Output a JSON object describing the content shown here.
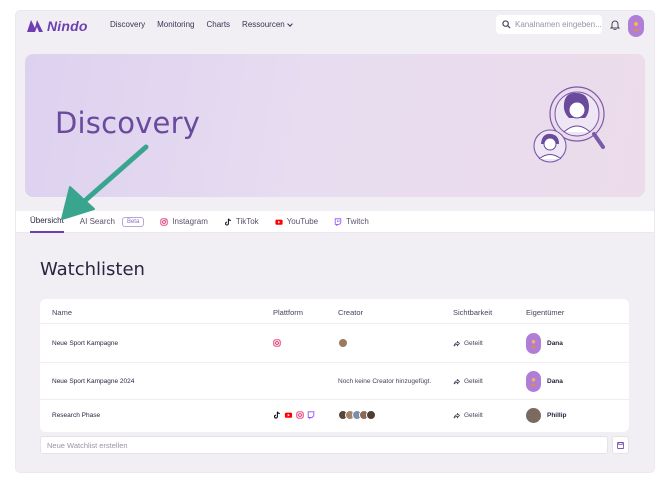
{
  "brand": {
    "name": "Nindo",
    "color": "#6d3fb0"
  },
  "nav": {
    "discovery": "Discovery",
    "monitoring": "Monitoring",
    "charts": "Charts",
    "ressourcen": "Ressourcen"
  },
  "search": {
    "placeholder": "Kanalnamen eingeben..."
  },
  "hero": {
    "title": "Discovery"
  },
  "tabs": {
    "overview": "Übersicht",
    "ai_search": "AI Search",
    "ai_badge": "Beta",
    "instagram": "Instagram",
    "tiktok": "TikTok",
    "youtube": "YouTube",
    "twitch": "Twitch"
  },
  "section": {
    "title": "Watchlisten"
  },
  "table": {
    "headers": {
      "name": "Name",
      "platform": "Plattform",
      "creator": "Creator",
      "visibility": "Sichtbarkeit",
      "owner": "Eigentümer"
    },
    "rows": [
      {
        "name": "Neue Sport Kampagne",
        "platforms": [
          "instagram"
        ],
        "creator_text": "",
        "visibility": "Geteilt",
        "owner": "Dana"
      },
      {
        "name": "Neue Sport Kampagne 2024",
        "platforms": [],
        "creator_text": "Noch keine Creator hinzugefügt.",
        "visibility": "Geteilt",
        "owner": "Dana"
      },
      {
        "name": "Research Phase",
        "platforms": [
          "tiktok",
          "youtube",
          "instagram",
          "twitch"
        ],
        "creator_text": "",
        "visibility": "Geteilt",
        "owner": "Phillip"
      }
    ]
  },
  "create": {
    "placeholder": "Neue Watchlist erstellen"
  },
  "colors": {
    "accent": "#6d3fb0",
    "arrow": "#3aa58e",
    "instagram": "#e1306c",
    "youtube": "#ff0000",
    "twitch": "#9146ff"
  }
}
